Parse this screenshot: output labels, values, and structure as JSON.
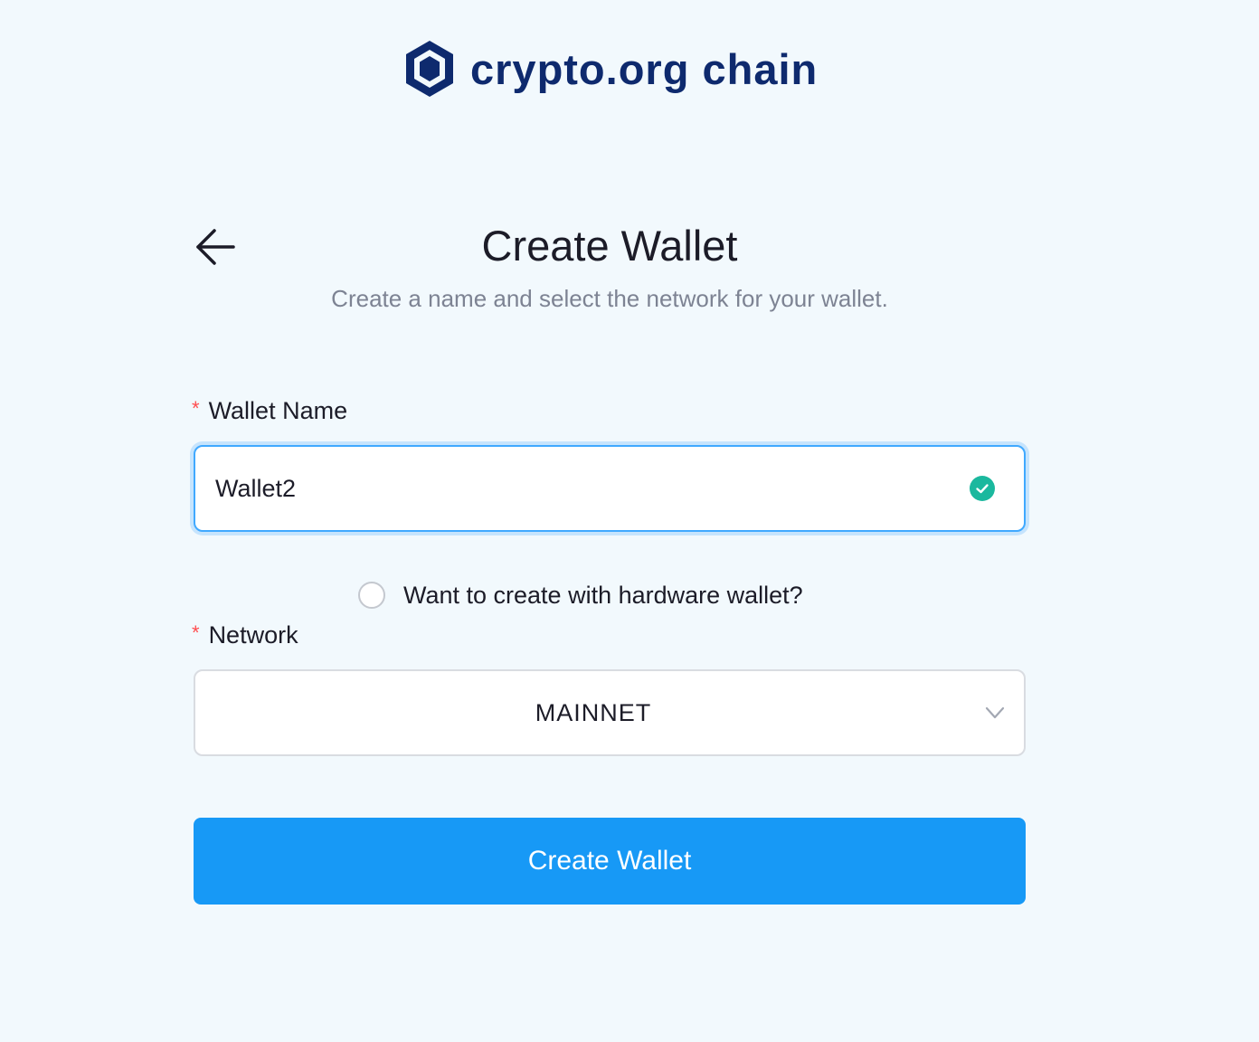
{
  "brand": {
    "name": "crypto.org chain",
    "logo_icon": "hexagon-logo-icon",
    "color": "#0e2a6e"
  },
  "header": {
    "back_icon": "arrow-left-icon",
    "title": "Create Wallet",
    "subtitle": "Create a name and select the network for your wallet."
  },
  "form": {
    "wallet_name": {
      "required_mark": "*",
      "label": "Wallet Name",
      "value": "Wallet2",
      "status_icon": "check-circle-icon",
      "status_color": "#1bb89e"
    },
    "hardware_wallet": {
      "label": "Want to create with hardware wallet?",
      "checked": false
    },
    "network": {
      "required_mark": "*",
      "label": "Network",
      "selected": "MAINNET",
      "dropdown_icon": "chevron-down-icon"
    },
    "submit_label": "Create Wallet",
    "accent_color": "#1799f6"
  }
}
